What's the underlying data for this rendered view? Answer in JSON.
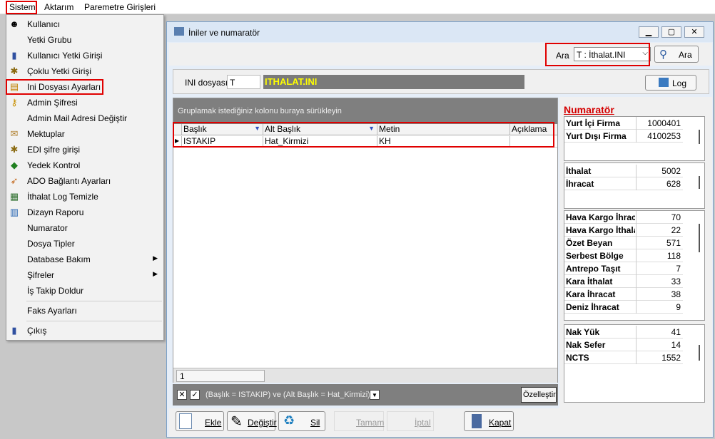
{
  "menubar": {
    "items": [
      "Sistem",
      "Aktarım",
      "Paremetre Girişleri"
    ]
  },
  "menu": {
    "items": [
      {
        "label": "Kullanıcı",
        "icon": "user-icon"
      },
      {
        "label": "Yetki Grubu",
        "icon": ""
      },
      {
        "label": "Kullanıcı Yetki Girişi",
        "icon": "user-key-icon"
      },
      {
        "label": "Çoklu Yetki Girişi",
        "icon": "multi-auth-icon"
      },
      {
        "label": "Ini Dosyası  Ayarları",
        "icon": "ini-file-icon"
      },
      {
        "label": "Admin Şifresi",
        "icon": "key-icon"
      },
      {
        "label": "Admin Mail Adresi Değiştir",
        "icon": ""
      },
      {
        "label": "Mektuplar",
        "icon": "letters-icon"
      },
      {
        "label": "EDI şifre girişi",
        "icon": "edi-key-icon"
      },
      {
        "label": "Yedek Kontrol",
        "icon": "backup-icon"
      },
      {
        "label": "ADO Bağlantı Ayarları",
        "icon": "connection-icon"
      },
      {
        "label": "İthalat Log Temizle",
        "icon": "log-clean-icon"
      },
      {
        "label": "Dizayn Raporu",
        "icon": "report-icon"
      },
      {
        "label": "Numarator",
        "icon": ""
      },
      {
        "label": "Dosya Tipler",
        "icon": ""
      },
      {
        "label": "Database Bakım",
        "icon": ""
      },
      {
        "label": "Şifreler",
        "icon": ""
      },
      {
        "label": "İş Takip Doldur",
        "icon": ""
      },
      {
        "label": "Faks Ayarları",
        "icon": ""
      },
      {
        "label": "Çıkış",
        "icon": "exit-icon"
      }
    ]
  },
  "window": {
    "title": "İniler ve numaratör",
    "search_label": "Ara",
    "search_value": "T : İthalat.INI",
    "search_button": "Ara",
    "ini_label": "INI dosyası",
    "ini_code": "T",
    "ini_name": "ITHALAT.INI",
    "log_button": "Log",
    "group_hint": "Gruplamak istediğiniz kolonu buraya sürükleyin",
    "columns": [
      "Başlık",
      "Alt Başlık",
      "Metin",
      "Açıklama"
    ],
    "rows": [
      [
        "ISTAKIP",
        "Hat_Kirmizi",
        "KH",
        ""
      ]
    ],
    "footer_count": "1",
    "filter_text": "(Başlık = ISTAKIP) ve (Alt Başlık = Hat_Kirmizi)",
    "customize_button": "Özelleştir",
    "buttons": {
      "add": "Ekle",
      "edit": "Değiştir",
      "delete": "Sil",
      "ok": "Tamam",
      "cancel": "İptal",
      "close": "Kapat"
    }
  },
  "numarator": {
    "title": "Numaratör",
    "group1": [
      {
        "k": "Yurt İçi Firma",
        "v": "1000401"
      },
      {
        "k": "Yurt Dışı Firma",
        "v": "4100253"
      }
    ],
    "group2": [
      {
        "k": "İthalat",
        "v": "5002"
      },
      {
        "k": "İhracat",
        "v": "628"
      }
    ],
    "group3": [
      {
        "k": "Hava Kargo İhracat",
        "v": "70"
      },
      {
        "k": "Hava Kargo İthalat",
        "v": "22"
      },
      {
        "k": "Özet Beyan",
        "v": "571"
      },
      {
        "k": "Serbest Bölge",
        "v": "118"
      },
      {
        "k": "Antrepo Taşıt",
        "v": "7"
      },
      {
        "k": "Kara İthalat",
        "v": "33"
      },
      {
        "k": "Kara İhracat",
        "v": "38"
      },
      {
        "k": "Deniz İhracat",
        "v": "9"
      }
    ],
    "group4": [
      {
        "k": "Nak Yük",
        "v": "41"
      },
      {
        "k": "Nak Sefer",
        "v": "14"
      },
      {
        "k": "NCTS",
        "v": "1552"
      }
    ]
  },
  "colors": {
    "highlight": "#e00000",
    "ini_name_bg": "#7a7a7a",
    "ini_name_fg": "#ffff00",
    "title_red": "#d40000"
  }
}
